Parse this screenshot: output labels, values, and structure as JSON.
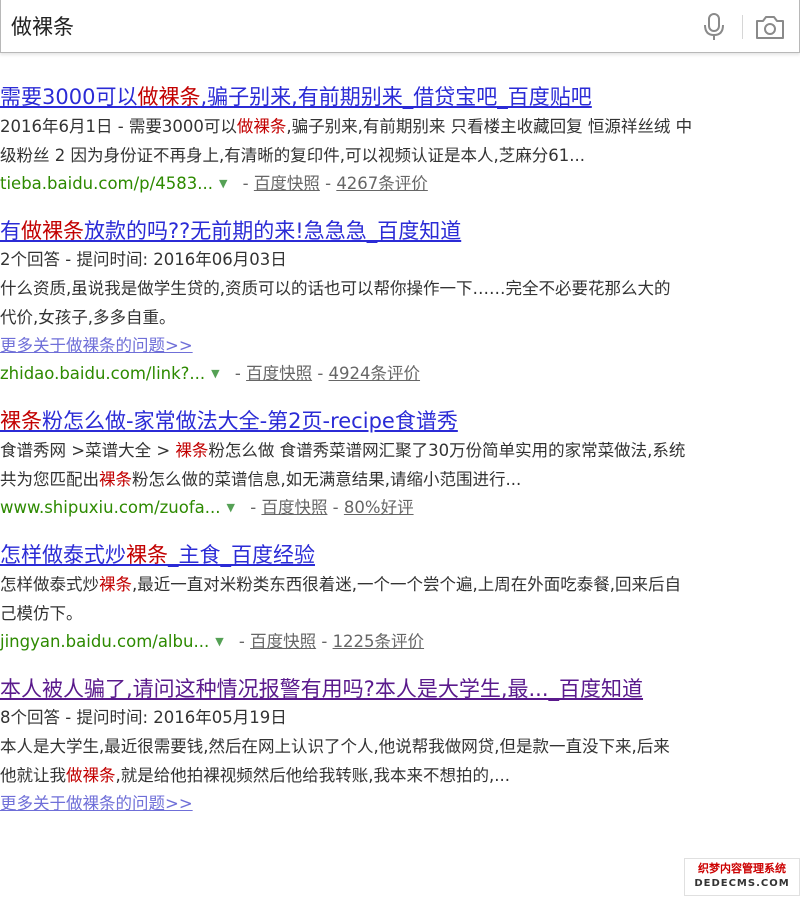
{
  "search": {
    "query": "做裸条"
  },
  "results": [
    {
      "title_pre": "需要3000可以",
      "title_hl": "做裸条",
      "title_post": ",骗子别来,有前期别来_借贷宝吧_百度贴吧",
      "abs1_pre": "2016年6月1日 - 需要3000可以",
      "abs1_hl": "做裸条",
      "abs1_post": ",骗子别来,有前期别来 只看楼主收藏回复 恒源祥丝绒 中",
      "abs2": "级粉丝 2 因为身份证不再身上,有清晰的复印件,可以视频认证是本人,芝麻分61...",
      "url": "tieba.baidu.com/p/4583...",
      "snapshot": "百度快照",
      "reviews": "4267条评价"
    },
    {
      "title_pre": "有",
      "title_hl": "做裸条",
      "title_post": "放款的吗??无前期的来!急急急_百度知道",
      "meta": "2个回答 - 提问时间: 2016年06月03日",
      "abs1": "什么资质,虽说我是做学生贷的,资质可以的话也可以帮你操作一下……完全不必要花那么大的",
      "abs2": "代价,女孩子,多多自重。",
      "more": "更多关于做裸条的问题>>",
      "url": "zhidao.baidu.com/link?...",
      "snapshot": "百度快照",
      "reviews": "4924条评价"
    },
    {
      "title_hl": "裸条",
      "title_post": "粉怎么做-家常做法大全-第2页-recipe食谱秀",
      "abs1_pre": "食谱秀网 >菜谱大全 > ",
      "abs1_hl": "裸条",
      "abs1_post": "粉怎么做 食谱秀菜谱网汇聚了30万份简单实用的家常菜做法,系统",
      "abs2_pre": "共为您匹配出",
      "abs2_hl": "裸条",
      "abs2_post": "粉怎么做的菜谱信息,如无满意结果,请缩小范围进行...",
      "url": "www.shipuxiu.com/zuofa...",
      "snapshot": "百度快照",
      "reviews": "80%好评"
    },
    {
      "title_pre": "怎样做泰式炒",
      "title_hl": "裸条",
      "title_post": "_主食_百度经验",
      "abs1_pre": "怎样做泰式炒",
      "abs1_hl": "裸条",
      "abs1_post": ",最近一直对米粉类东西很着迷,一个一个尝个遍,上周在外面吃泰餐,回来后自",
      "abs2": "己模仿下。",
      "url": "jingyan.baidu.com/albu...",
      "snapshot": "百度快照",
      "reviews": "1225条评价"
    },
    {
      "title": "本人被人骗了,请问这种情况报警有用吗?本人是大学生,最..._百度知道",
      "meta": "8个回答 - 提问时间: 2016年05月19日",
      "abs1": "本人是大学生,最近很需要钱,然后在网上认识了个人,他说帮我做网贷,但是款一直没下来,后来",
      "abs2_pre": "他就让我",
      "abs2_hl": "做裸条",
      "abs2_post": ",就是给他拍裸视频然后他给我转账,我本来不想拍的,...",
      "more": "更多关于做裸条的问题>>"
    }
  ],
  "watermark": {
    "line1": "织梦内容管理系统",
    "line2": "DEDECMS.COM"
  }
}
